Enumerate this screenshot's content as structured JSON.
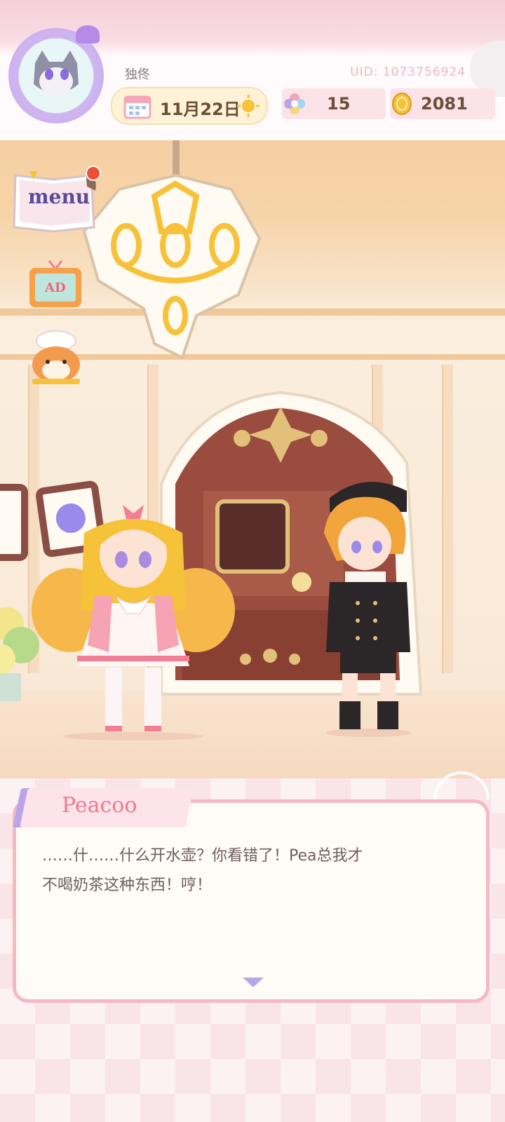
{
  "header": {
    "player_name": "独佟",
    "uid": "UID: 1073756924",
    "date": "11月22日",
    "gems": "15",
    "coins": "2081"
  },
  "side_buttons": {
    "menu_label": "menu",
    "ad_label": "AD"
  },
  "dialog": {
    "speaker": "Peacoo",
    "text": "……什……什么开水壶？你看错了！Pea总我才\n不喝奶茶这种东西！哼！"
  },
  "colors": {
    "accent_pink": "#f4b9c4",
    "speaker_pink": "#f1798f",
    "lavender": "#b9a6e8",
    "gold": "#f6c23a"
  },
  "icons": [
    "avatar-cat",
    "calendar-icon",
    "sun-icon",
    "gem-icon",
    "coin-icon",
    "menu-book-icon",
    "notification-dot",
    "ad-tv-icon",
    "hamster-chef-icon",
    "next-arrow-icon"
  ]
}
